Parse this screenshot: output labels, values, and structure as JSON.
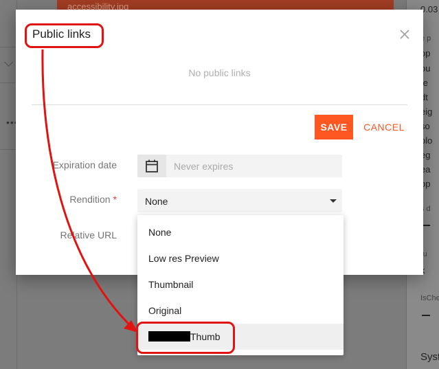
{
  "background": {
    "banner_text": "accessibility.jpg",
    "dots": "•••",
    "right_panel": {
      "time_fragment": "0.03",
      "small_fragment": "e p",
      "lines": [
        "op",
        "ou",
        "te",
        "dt",
        "eig",
        "so",
        "olo",
        "eg",
        "ea",
        "op"
      ],
      "label_2": "s d",
      "label_3": "ru",
      "value_3": "k",
      "label_4": "IsChe",
      "heading": "Syst"
    }
  },
  "dialog": {
    "title": "Public links",
    "empty_message": "No public links",
    "save_label": "SAVE",
    "cancel_label": "CANCEL",
    "expiration": {
      "label": "Expiration date",
      "placeholder": "Never expires",
      "icon": "calendar-icon"
    },
    "rendition": {
      "label": "Rendition",
      "required_mark": "*",
      "selected": "None",
      "options": [
        "None",
        "Low res Preview",
        "Thumbnail",
        "Original",
        "Thumb"
      ]
    },
    "relative_url": {
      "label": "Relative URL"
    }
  },
  "annotation_color": "#e01212",
  "accent_color": "#ff5722"
}
